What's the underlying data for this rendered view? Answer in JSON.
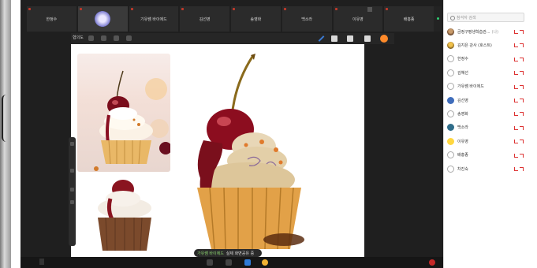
{
  "participant_strip": {
    "tiles": [
      "한정수",
      "",
      "기유쌤 바이에드",
      "김선영",
      "송영화",
      "백소라",
      "이유영",
      "배홍종"
    ]
  },
  "drawing_toolbar": {
    "label": "협의도"
  },
  "caption_pill": {
    "user": "가유쌤 바이에드",
    "message": "실제 화면공유 중"
  },
  "participants_panel": {
    "search_placeholder": "참석자 검색",
    "people": [
      {
        "name": "금정구평생학습관...",
        "tag": "(나)",
        "avatar": "photo"
      },
      {
        "name": "김지은 강사 (호스트)",
        "tag": "",
        "avatar": "photo2"
      },
      {
        "name": "한정수",
        "tag": "",
        "avatar": "outline"
      },
      {
        "name": "김혜선",
        "tag": "",
        "avatar": "outline"
      },
      {
        "name": "가유쌤 바이에드",
        "tag": "",
        "avatar": "outline"
      },
      {
        "name": "김선영",
        "tag": "",
        "avatar": "blue"
      },
      {
        "name": "송영화",
        "tag": "",
        "avatar": "outline"
      },
      {
        "name": "백소라",
        "tag": "",
        "avatar": "teal"
      },
      {
        "name": "이유영",
        "tag": "",
        "avatar": "yellow"
      },
      {
        "name": "배홍종",
        "tag": "",
        "avatar": "outline"
      },
      {
        "name": "차진숙",
        "tag": "",
        "avatar": "outline"
      }
    ]
  },
  "colors": {
    "accent_orange": "#ff8a2a",
    "pen_blue": "#3b7bd4",
    "status_green": "#2ecc71",
    "muted_red": "#d33333"
  }
}
